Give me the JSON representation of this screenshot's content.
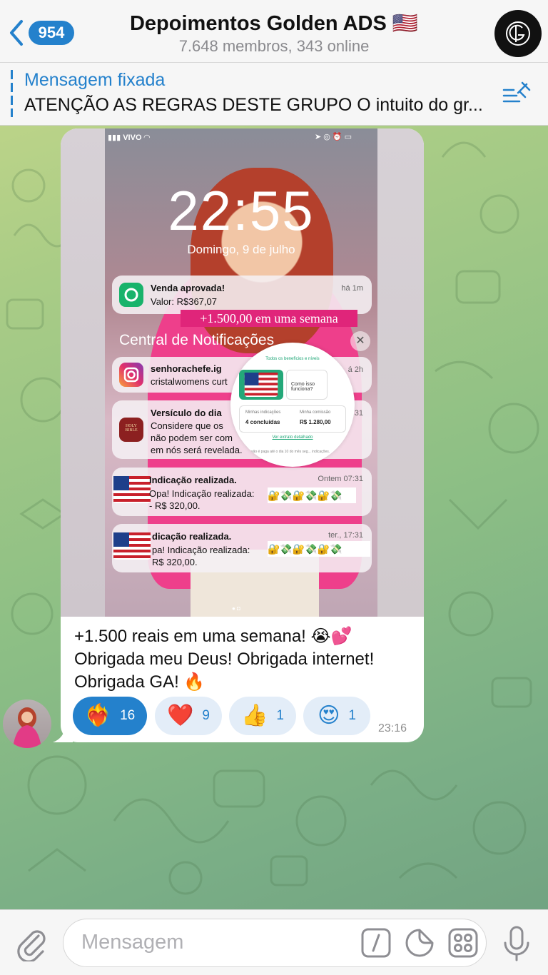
{
  "header": {
    "back_count": "954",
    "title": "Depoimentos Golden ADS 🇺🇸",
    "subtitle": "7.648 membros, 343 online"
  },
  "pinned": {
    "title": "Mensagem fixada",
    "text": "ATENÇÃO AS REGRAS DESTE GRUPO O intuito do gr..."
  },
  "screenshot": {
    "carrier": "VIVO",
    "clock": "22:55",
    "date": "Domingo, 9 de julho",
    "promo": "+1.500,00 em uma semana",
    "central_title": "Central de Notificações",
    "notifications": [
      {
        "title": "Venda aprovada!",
        "body": "Valor: R$367,07",
        "time": "há 1m"
      },
      {
        "title": "senhorachefe.ig",
        "body": "cristalwomens curt",
        "time": "á 2h"
      },
      {
        "title": "Versículo do dia",
        "body1": "Considere que os",
        "body2": "não podem ser com",
        "body3": "em nós será revelada.",
        "time": "31",
        "icon_text": "HOLY BIBLE"
      },
      {
        "title": "Indicação realizada.",
        "body1": "Opa! Indicação realizada:",
        "body2": "- R$ 320,00.",
        "time": "Ontem 07:31"
      },
      {
        "title": "dicação realizada.",
        "body1": "pa! Indicação realizada:",
        "body2": "R$ 320,00.",
        "time": "ter., 17:31"
      }
    ],
    "magnifier": {
      "header": "Todos os benefícios e níveis",
      "box_text": "Como isso funciona?",
      "stat1_label": "Minhas indicações",
      "stat1_value": "4 concluídas",
      "stat2_label": "Minha comissão",
      "stat2_value": "R$ 1.280,00",
      "link": "Ver extrato detalhado",
      "foot": "comissão é paga até o dia 10 do mês seg... indicações."
    },
    "emoji_strip": "🔐💸🔐💸🔐💸"
  },
  "message": {
    "line1": "+1.500 reais em uma semana! 😭💕",
    "line2": "Obrigada meu Deus! Obrigada internet!",
    "line3": "Obrigada GA! 🔥",
    "time": "23:16",
    "reactions": [
      {
        "emoji": "❤️‍🔥",
        "count": "16"
      },
      {
        "emoji": "❤️",
        "count": "9"
      },
      {
        "emoji": "👍",
        "count": "1"
      },
      {
        "emoji": "😍",
        "count": "1"
      }
    ]
  },
  "input": {
    "placeholder": "Mensagem"
  },
  "colors": {
    "accent": "#2481cc",
    "reaction_bg": "#e3edf8",
    "pink": "#e0257a"
  }
}
